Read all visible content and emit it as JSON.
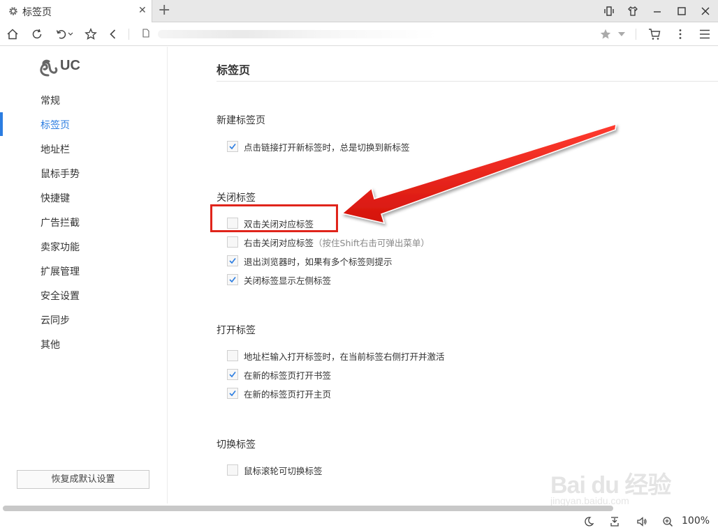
{
  "window": {
    "tab_title": "标签页",
    "tab_icon": "gear-icon",
    "new_tab_icon": "plus-icon",
    "controls": [
      "vibrate-icon",
      "shirt-icon",
      "minimize-icon",
      "maximize-icon",
      "close-icon"
    ]
  },
  "toolbar": {
    "icons": [
      "home-icon",
      "reload-icon",
      "undo-icon",
      "star-icon",
      "back-icon"
    ],
    "address_icon": "document-icon",
    "right_icons": [
      "bookmark-star-icon",
      "dropdown-icon",
      "cart-icon",
      "more-icon",
      "menu-icon"
    ]
  },
  "sidebar": {
    "logo_text": "UC",
    "items": [
      {
        "label": "常规"
      },
      {
        "label": "标签页",
        "active": true
      },
      {
        "label": "地址栏"
      },
      {
        "label": "鼠标手势"
      },
      {
        "label": "快捷键"
      },
      {
        "label": "广告拦截"
      },
      {
        "label": "卖家功能"
      },
      {
        "label": "扩展管理"
      },
      {
        "label": "安全设置"
      },
      {
        "label": "云同步"
      },
      {
        "label": "其他"
      }
    ],
    "restore_label": "恢复成默认设置"
  },
  "main": {
    "title": "标签页",
    "sections": [
      {
        "title": "新建标签页",
        "options": [
          {
            "label": "点击链接打开新标签时，总是切换到新标签",
            "checked": true
          }
        ]
      },
      {
        "title": "关闭标签",
        "options": [
          {
            "label": "双击关闭对应标签",
            "checked": false
          },
          {
            "label": "右击关闭对应标签",
            "hint": "（按住Shift右击可弹出菜单）",
            "checked": false
          },
          {
            "label": "退出浏览器时，如果有多个标签则提示",
            "checked": true
          },
          {
            "label": "关闭标签显示左侧标签",
            "checked": true
          }
        ]
      },
      {
        "title": "打开标签",
        "options": [
          {
            "label": "地址栏输入打开标签时，在当前标签右侧打开并激活",
            "checked": false
          },
          {
            "label": "在新的标签页打开书签",
            "checked": true
          },
          {
            "label": "在新的标签页打开主页",
            "checked": true
          }
        ]
      },
      {
        "title": "切换标签",
        "options": [
          {
            "label": "鼠标滚轮可切换标签",
            "checked": false
          }
        ]
      }
    ]
  },
  "annotation": {
    "highlight_color": "#e0241b",
    "arrow_color": "#e0241b"
  },
  "statusbar": {
    "icons": [
      "moon-icon",
      "download-icon",
      "volume-icon",
      "zoom-icon"
    ],
    "zoom": "100%"
  },
  "watermark": {
    "text": "Bai du 经验",
    "sub": "jingyan.baidu.com"
  },
  "colors": {
    "accent": "#2b7de1",
    "check": "#2b7de1"
  }
}
